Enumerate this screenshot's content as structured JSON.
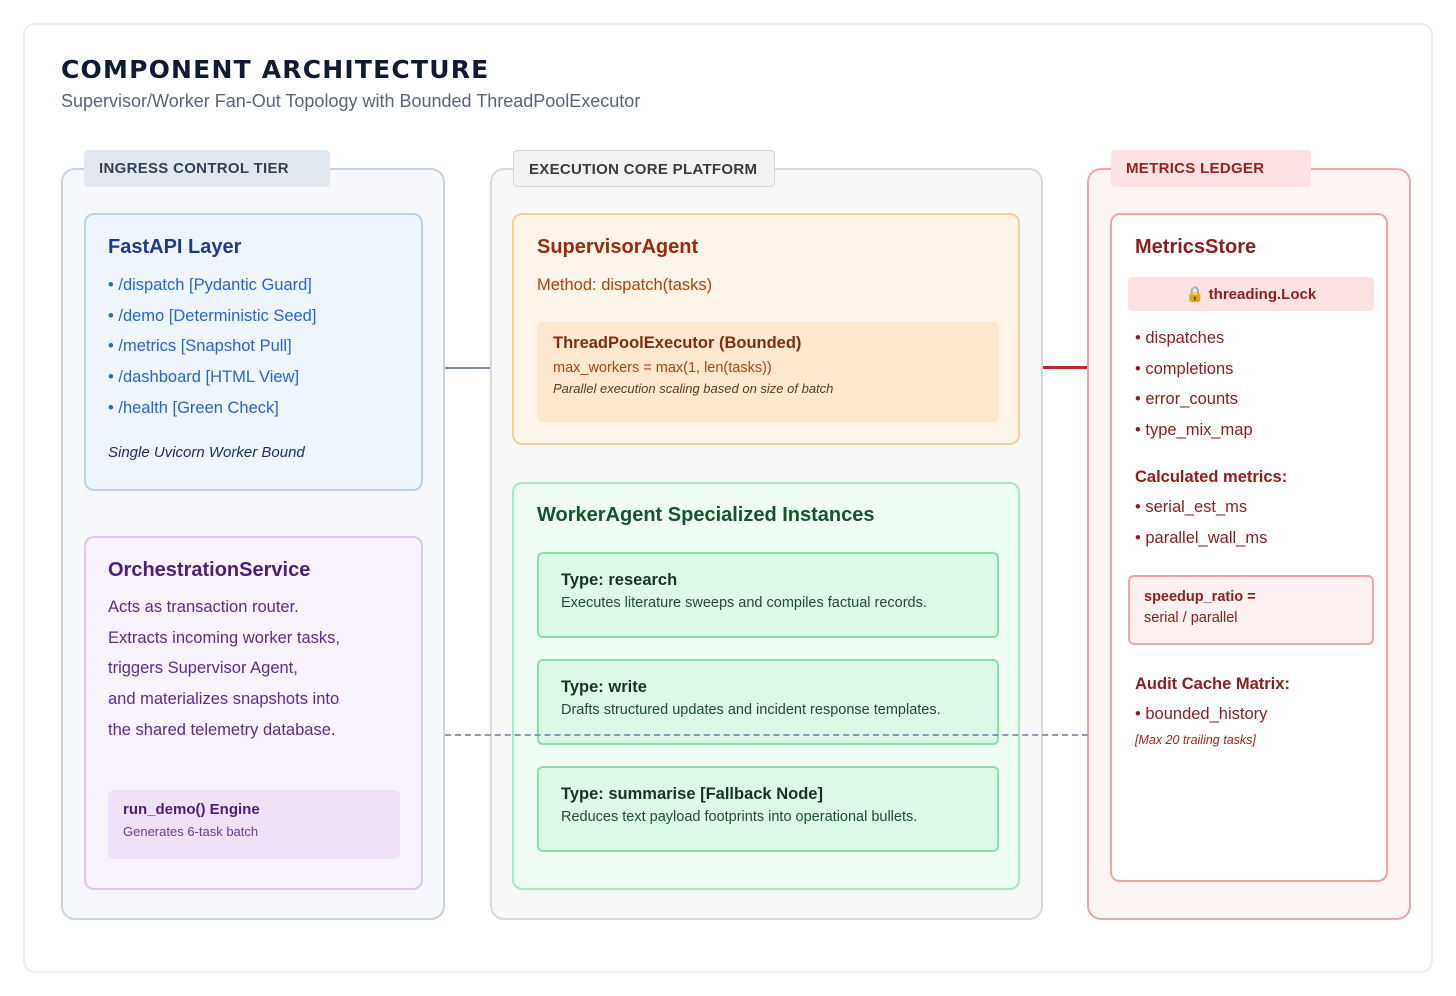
{
  "header": {
    "title": "COMPONENT ARCHITECTURE",
    "subtitle": "Supervisor/Worker Fan-Out Topology with Bounded ThreadPoolExecutor"
  },
  "tiers": {
    "ingress": {
      "label": "INGRESS CONTROL TIER",
      "fastapi": {
        "title": "FastAPI Layer",
        "routes": [
          "• /dispatch [Pydantic Guard]",
          "• /demo [Deterministic Seed]",
          "• /metrics [Snapshot Pull]",
          "• /dashboard [HTML View]",
          "• /health [Green Check]"
        ],
        "note": "Single Uvicorn Worker Bound"
      },
      "orchestration": {
        "title": "OrchestrationService",
        "lines": [
          "Acts as transaction router.",
          "Extracts incoming worker tasks,",
          "triggers Supervisor Agent,",
          "and materializes snapshots into",
          "the shared telemetry database."
        ],
        "engine_title": "run_demo() Engine",
        "engine_sub": "Generates 6-task batch"
      }
    },
    "execution": {
      "label": "EXECUTION CORE PLATFORM",
      "supervisor": {
        "title": "SupervisorAgent",
        "method": "Method: dispatch(tasks)",
        "pool_title": "ThreadPoolExecutor (Bounded)",
        "pool_code": "max_workers = max(1, len(tasks))",
        "pool_note": "Parallel execution scaling based on size of batch"
      },
      "worker": {
        "title": "WorkerAgent Specialized Instances",
        "types": [
          {
            "title": "Type: research",
            "desc": "Executes literature sweeps and compiles factual records."
          },
          {
            "title": "Type: write",
            "desc": "Drafts structured updates and incident response templates."
          },
          {
            "title": "Type: summarise [Fallback Node]",
            "desc": "Reduces text payload footprints into operational bullets."
          }
        ]
      }
    },
    "metrics": {
      "label": "METRICS LEDGER",
      "store": {
        "title": "MetricsStore",
        "lock_icon": "lock-icon",
        "lock_glyph": "🔒",
        "lock_label": "threading.Lock",
        "counters": [
          "• dispatches",
          "• completions",
          "• error_counts",
          "• type_mix_map"
        ],
        "calculated_heading": "Calculated metrics:",
        "calculated": [
          "• serial_est_ms",
          "• parallel_wall_ms"
        ],
        "ratio_title": "speedup_ratio =",
        "ratio_formula": "serial / parallel",
        "audit_heading": "Audit Cache Matrix:",
        "audit_items": [
          "• bounded_history"
        ],
        "audit_note": "[Max 20 trailing tasks]"
      }
    }
  }
}
